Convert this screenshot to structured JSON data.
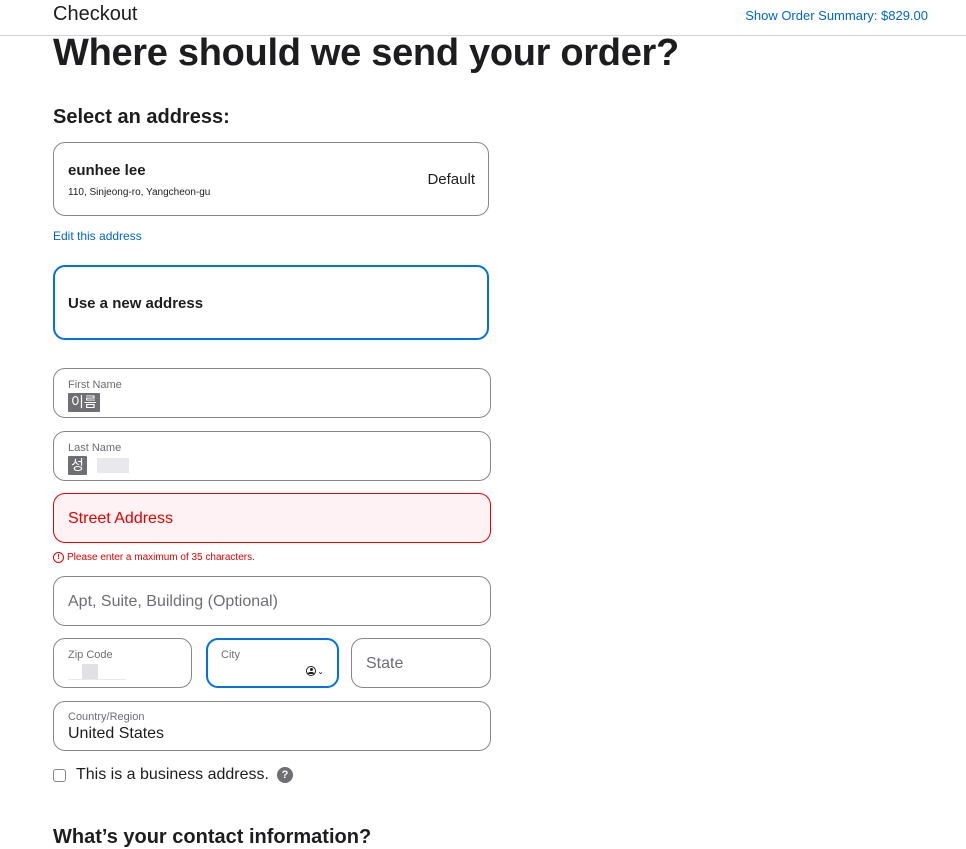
{
  "header": {
    "title": "Checkout",
    "summary_link": "Show Order Summary: $829.00"
  },
  "main": {
    "heading": "Where should we send your order?",
    "select_address_heading": "Select an address:",
    "saved_address": {
      "name": "eunhee lee",
      "line": "110, Sinjeong-ro, Yangcheon-gu",
      "tag": "Default"
    },
    "edit_link": "Edit this address",
    "new_address_label": "Use a new address",
    "form": {
      "first_name": {
        "label": "First Name",
        "value": "이름"
      },
      "last_name": {
        "label": "Last Name",
        "value": "성"
      },
      "street": {
        "placeholder": "Street Address",
        "error": "Please enter a maximum of 35 characters."
      },
      "apt": {
        "placeholder": "Apt, Suite, Building (Optional)"
      },
      "zip": {
        "label": "Zip Code"
      },
      "city": {
        "label": "City"
      },
      "state": {
        "placeholder": "State"
      },
      "country": {
        "label": "Country/Region",
        "value": "United States"
      },
      "business_checkbox": {
        "label": "This is a business address.",
        "checked": false,
        "help": "?"
      }
    },
    "contact_heading": "What’s your contact information?"
  },
  "colors": {
    "accent": "#0071e3",
    "link": "#0066cc",
    "error": "#e30000"
  },
  "icons": {
    "error": "error-circle-icon",
    "autofill": "person-autofill-icon",
    "help": "question-icon"
  }
}
